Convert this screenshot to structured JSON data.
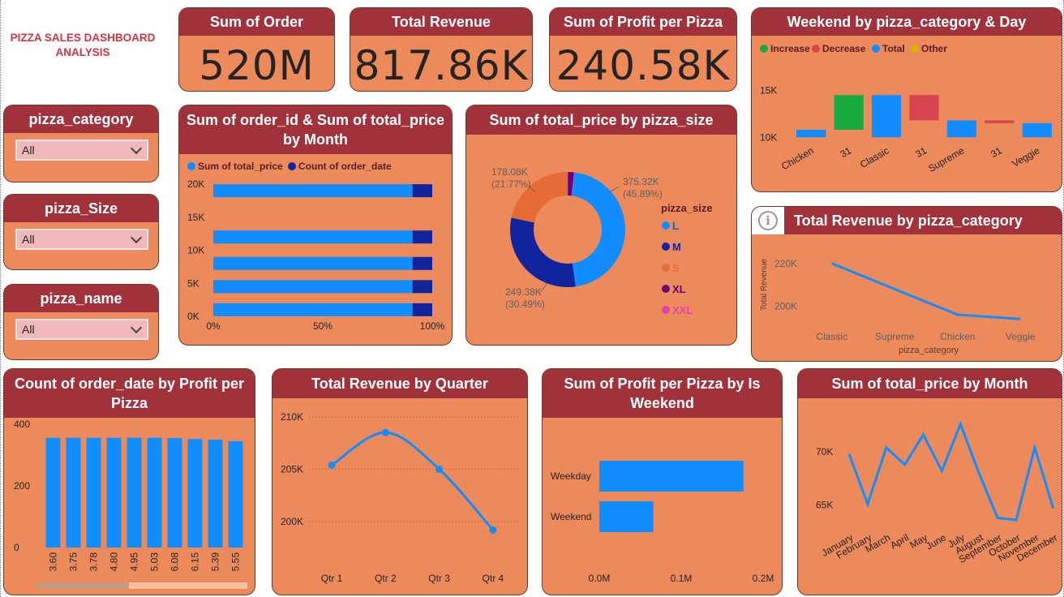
{
  "dashboard_title": "PIZZA SALES DASHBOARD ANALYSIS",
  "kpis": [
    {
      "title": "Sum of Order",
      "value": "520M"
    },
    {
      "title": "Total Revenue",
      "value": "817.86K"
    },
    {
      "title": "Sum of Profit per Pizza",
      "value": "240.58K"
    }
  ],
  "slicers": [
    {
      "title": "pizza_category",
      "value": "All"
    },
    {
      "title": "pizza_Size",
      "value": "All"
    },
    {
      "title": "pizza_name",
      "value": "All"
    }
  ],
  "colors": {
    "card_bg": "#ec8a5c",
    "header_bg": "#a1323c",
    "blue": "#118dff",
    "dark_blue": "#12239e",
    "orange": "#e66c37",
    "purple": "#6b007b",
    "pink": "#e044a7",
    "green": "#1aab40",
    "red": "#d64550",
    "yellow": "#d9b300"
  },
  "chart_data": [
    {
      "id": "waterfall",
      "type": "bar",
      "subtype": "waterfall",
      "title": "Weekend by pizza_category & Day",
      "legend": [
        "Increase",
        "Decrease",
        "Total",
        "Other"
      ],
      "categories": [
        "Chicken",
        "31",
        "Classic",
        "31",
        "Supreme",
        "31",
        "Veggie"
      ],
      "bars": [
        {
          "start": 10000,
          "end": 10800,
          "kind": "Total"
        },
        {
          "start": 10800,
          "end": 14500,
          "kind": "Increase"
        },
        {
          "start": 10000,
          "end": 14500,
          "kind": "Total"
        },
        {
          "start": 14500,
          "end": 11800,
          "kind": "Decrease"
        },
        {
          "start": 10000,
          "end": 11800,
          "kind": "Total"
        },
        {
          "start": 11800,
          "end": 11500,
          "kind": "Decrease"
        },
        {
          "start": 10000,
          "end": 11500,
          "kind": "Total"
        }
      ],
      "ytick_labels": [
        "15K",
        "10K"
      ],
      "yticks": [
        15000,
        10000
      ],
      "ylim": [
        7000,
        16500
      ]
    },
    {
      "id": "stacked",
      "type": "bar",
      "subtype": "100% stacked horizontal",
      "title": "Sum of order_id & Sum of total_price by Month",
      "series": [
        {
          "name": "Sum of total_price",
          "share": 0.91
        },
        {
          "name": "Count of order_date",
          "share": 0.09
        }
      ],
      "y_bars": [
        19000,
        12000,
        8000,
        4500,
        1000
      ],
      "yticks": [
        "20K",
        "15K",
        "10K",
        "5K",
        "0K"
      ],
      "ytick_values": [
        20000,
        15000,
        10000,
        5000,
        0
      ],
      "xticks": [
        "0%",
        "50%",
        "100%"
      ],
      "ylim": [
        0,
        20000
      ]
    },
    {
      "id": "donut",
      "type": "pie",
      "subtype": "donut",
      "title": "Sum of total_price by pizza_size",
      "legend_title": "pizza_size",
      "slices": [
        {
          "name": "L",
          "value": 375320,
          "label": "375.32K",
          "pct": "(45.89%)"
        },
        {
          "name": "M",
          "value": 249380,
          "label": "249.38K",
          "pct": "(30.49%)"
        },
        {
          "name": "S",
          "value": 178080,
          "label": "178.08K",
          "pct": "(21.77%)"
        },
        {
          "name": "XL",
          "value": 14080
        },
        {
          "name": "XXL",
          "value": 1000
        }
      ]
    },
    {
      "id": "cat_line",
      "type": "line",
      "title": "Total Revenue by pizza_category",
      "categories": [
        "Classic",
        "Supreme",
        "Chicken",
        "Veggie"
      ],
      "values": [
        220000,
        208000,
        196000,
        194000
      ],
      "xlabel": "pizza_category",
      "ylabel": "Total Revenue",
      "yticks": [
        220000,
        200000
      ],
      "ytick_labels": [
        "220K",
        "200K"
      ],
      "ylim": [
        188000,
        226000
      ]
    },
    {
      "id": "profit_bars",
      "type": "bar",
      "title": "Count of order_date by Profit per Pizza",
      "categories": [
        "3.60",
        "3.75",
        "3.78",
        "4.80",
        "4.95",
        "5.03",
        "6.08",
        "6.15",
        "5.39",
        "5.55"
      ],
      "values": [
        356,
        356,
        356,
        356,
        356,
        356,
        355,
        352,
        350,
        345
      ],
      "yticks": [
        400,
        200,
        0
      ],
      "ylim": [
        0,
        400
      ]
    },
    {
      "id": "quarter",
      "type": "line",
      "title": "Total Revenue by Quarter",
      "categories": [
        "Qtr 1",
        "Qtr 2",
        "Qtr 3",
        "Qtr 4"
      ],
      "values": [
        205400,
        208500,
        205000,
        199200
      ],
      "yticks": [
        210000,
        205000,
        200000
      ],
      "ytick_labels": [
        "210K",
        "205K",
        "200K"
      ],
      "ylim": [
        198000,
        211000
      ]
    },
    {
      "id": "weekend",
      "type": "bar",
      "subtype": "horizontal",
      "title": "Sum of Profit per Pizza by Is Weekend",
      "categories": [
        "Weekday",
        "Weekend"
      ],
      "values": [
        176000,
        66000
      ],
      "xticks": [
        0,
        100000,
        200000
      ],
      "xtick_labels": [
        "0.0M",
        "0.1M",
        "0.2M"
      ],
      "xlim": [
        0,
        200000
      ]
    },
    {
      "id": "month_line",
      "type": "line",
      "title": "Sum of total_price by Month",
      "categories": [
        "January",
        "February",
        "March",
        "April",
        "May",
        "June",
        "July",
        "August",
        "September",
        "October",
        "November",
        "December"
      ],
      "values": [
        69800,
        65100,
        70400,
        68800,
        71600,
        68200,
        72600,
        68000,
        63800,
        63600,
        70400,
        64700
      ],
      "yticks": [
        70000,
        65000
      ],
      "ytick_labels": [
        "70K",
        "65K"
      ],
      "ylim": [
        63000,
        73500
      ]
    }
  ]
}
